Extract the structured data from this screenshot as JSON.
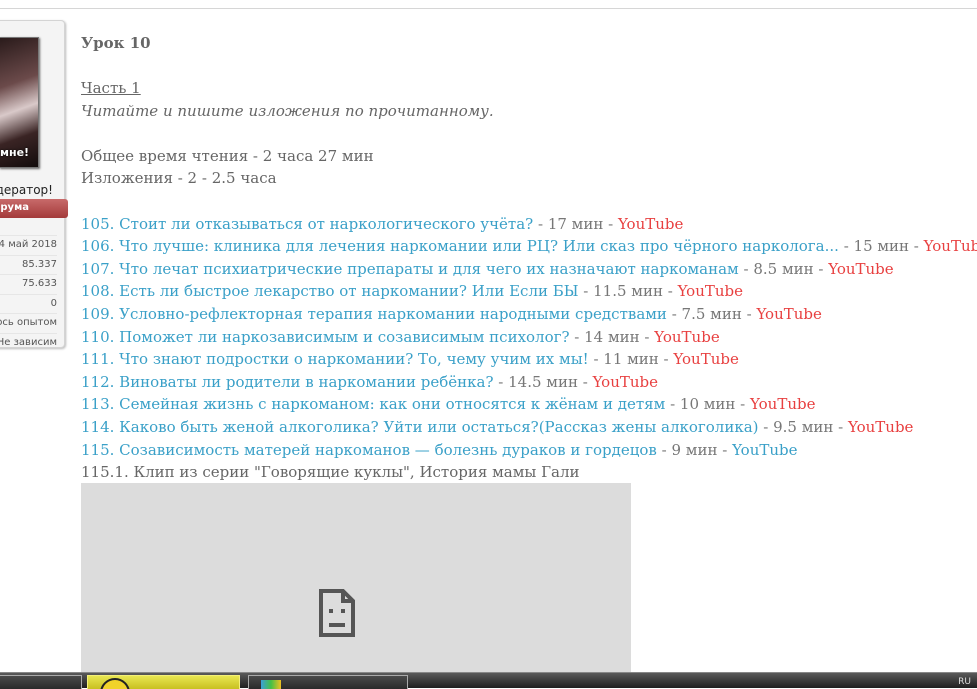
{
  "user_card": {
    "avatar_text": "мне!",
    "rank": "дератор!",
    "rank_label": "орума",
    "stats": [
      "4 май 2018",
      "85.337",
      "75.633",
      "0",
      "юсь опытом",
      "Не зависим"
    ]
  },
  "lesson": {
    "title": "Урок 10",
    "part": "Часть 1",
    "instruction": "Читайте и пишите изложения по прочитанному.",
    "reading_time": "Общее время чтения - 2 часа 27 мин",
    "retelling_time": "Изложения - 2 - 2.5 часа"
  },
  "items": [
    {
      "title": "105. Стоит ли отказываться от наркологического учёта?",
      "duration": " - 17 мин - ",
      "source": "YouTube",
      "source_color": "red"
    },
    {
      "title": "106. Что лучше: клиника для лечения наркомании или РЦ? Или сказ про чёрного нарколога...",
      "duration": " - 15 мин - ",
      "source": "YouTube",
      "source_color": "red"
    },
    {
      "title": "107. Что лечат психиатрические препараты и для чего их назначают наркоманам",
      "duration": " - 8.5 мин - ",
      "source": "YouTube",
      "source_color": "red"
    },
    {
      "title": "108. Есть ли быстрое лекарство от наркомании? Или Если БЫ",
      "duration": " - 11.5 мин - ",
      "source": "YouTube",
      "source_color": "red"
    },
    {
      "title": "109. Условно-рефлекторная терапия наркомании народными средствами",
      "duration": " - 7.5 мин - ",
      "source": "YouTube",
      "source_color": "red"
    },
    {
      "title": "110. Поможет ли наркозависимым и созависимым психолог?",
      "duration": " - 14 мин - ",
      "source": "YouTube",
      "source_color": "red"
    },
    {
      "title": "111. Что знают подростки о наркомании? То, чему учим их мы!",
      "duration": " - 11 мин - ",
      "source": "YouTube",
      "source_color": "red"
    },
    {
      "title": "112. Виноваты ли родители в наркомании ребёнка?",
      "duration": " - 14.5 мин - ",
      "source": "YouTube",
      "source_color": "red"
    },
    {
      "title": "113. Семейная жизнь с наркоманом: как они относятся к жёнам и детям",
      "duration": " - 10 мин - ",
      "source": "YouTube",
      "source_color": "red"
    },
    {
      "title": "114. Каково быть женой алкоголика? Уйти или остаться?(Рассказ жены алкоголика)",
      "duration": " - 9.5 мин - ",
      "source": "YouTube",
      "source_color": "red"
    },
    {
      "title": "115. Созависимость матерей наркоманов — болезнь дураков и гордецов",
      "duration": " - 9 мин - ",
      "source": "YouTube",
      "source_color": "blue"
    }
  ],
  "clip_caption": "115.1. Клип из серии \"Говорящие куклы\", История мамы Гали",
  "colors": {
    "link": "#3aa0c8",
    "youtube": "#e84040",
    "text": "#666666"
  },
  "icons": {
    "video_placeholder": "broken-document-icon"
  },
  "taskbar": {
    "tray_text": "RU"
  }
}
